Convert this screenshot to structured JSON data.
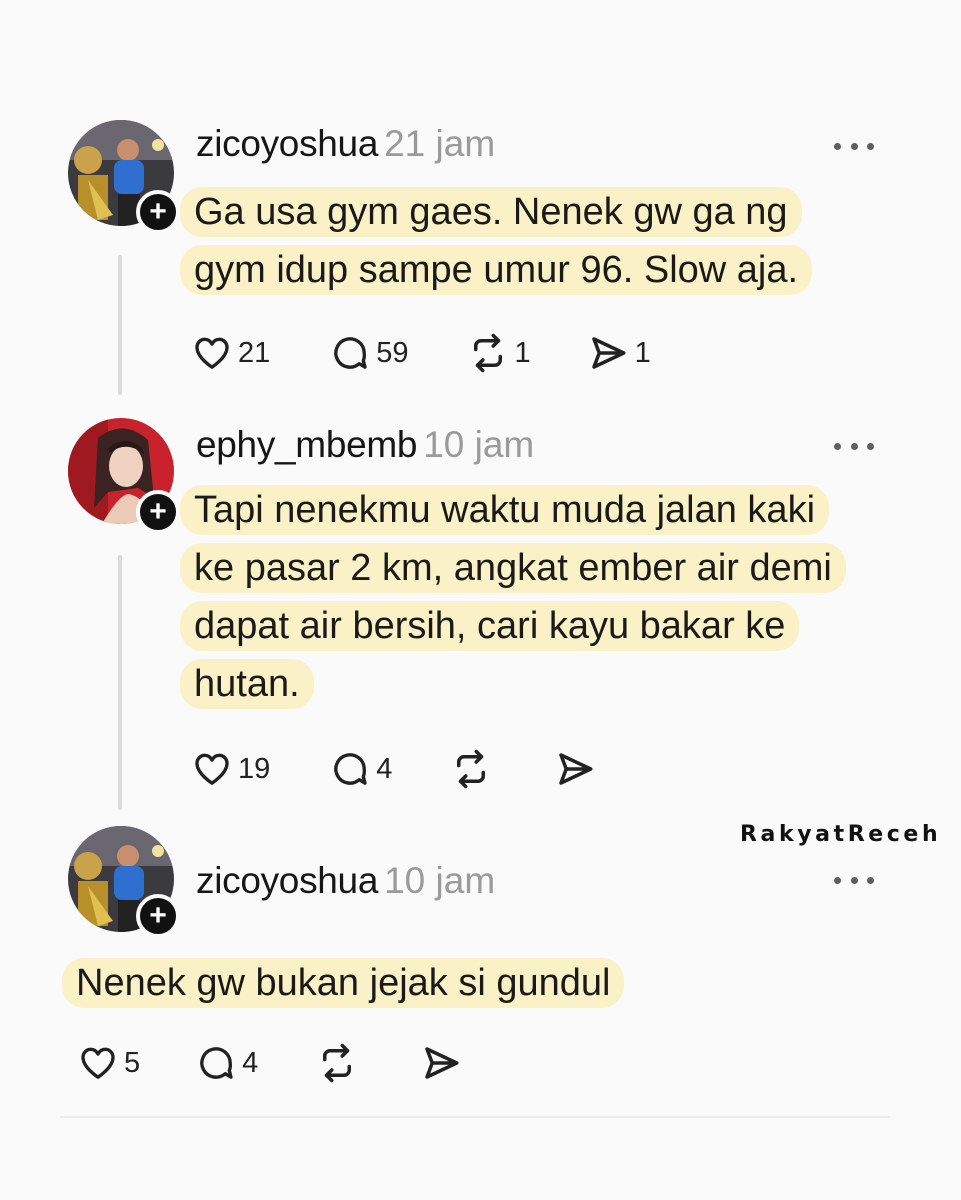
{
  "watermark": "RakyatReceh",
  "posts": [
    {
      "username": "zicoyoshua",
      "time": "21 jam",
      "lines": [
        "Ga usa gym gaes. Nenek gw ga ng",
        "gym idup sampe umur 96. Slow aja."
      ],
      "likes": "21",
      "replies": "59",
      "reposts": "1",
      "shares": "1",
      "avatar_icon": "profile-photo-man-blue-shirt"
    },
    {
      "username": "ephy_mbemb",
      "time": "10 jam",
      "lines": [
        "Tapi nenekmu waktu muda jalan kaki",
        "ke pasar 2 km, angkat ember air demi",
        "dapat air bersih, cari kayu bakar ke",
        "hutan."
      ],
      "likes": "19",
      "replies": "4",
      "reposts": "",
      "shares": "",
      "avatar_icon": "profile-photo-woman-red-background"
    },
    {
      "username": "zicoyoshua",
      "time": "10 jam",
      "lines": [
        "Nenek gw bukan jejak si gundul"
      ],
      "likes": "5",
      "replies": "4",
      "reposts": "",
      "shares": "",
      "avatar_icon": "profile-photo-man-blue-shirt"
    }
  ],
  "icons": {
    "like": "heart-icon",
    "reply": "comment-bubble-icon",
    "repost": "repost-icon",
    "share": "send-icon",
    "more": "more-dots-icon",
    "follow": "plus-icon"
  },
  "colors": {
    "highlight": "#fbf1c6",
    "text": "#141414",
    "muted": "#9a9a9a",
    "background": "#fafafa"
  }
}
